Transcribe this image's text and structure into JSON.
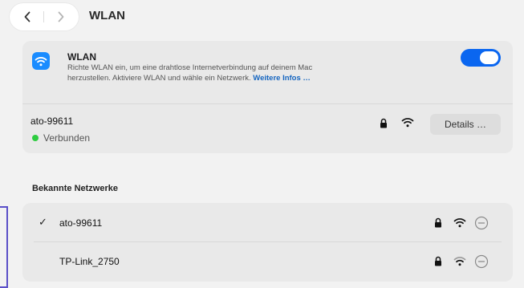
{
  "toolbar": {
    "title": "WLAN",
    "back_icon": "chevron-left-icon",
    "forward_icon": "chevron-right-icon"
  },
  "wlan_section": {
    "title": "WLAN",
    "description_line1": "Richte WLAN ein, um eine drahtlose Internetverbindung auf deinem Mac",
    "description_line2": "herzustellen. Aktiviere WLAN und wähle ein Netzwerk.",
    "more_link": "Weitere Infos …",
    "toggle_on": true,
    "icon": "wifi-icon",
    "accent_color": "#0a66f0"
  },
  "current_network": {
    "name": "ato-99611",
    "status": "Verbunden",
    "status_color": "#2ecc40",
    "details_label": "Details …"
  },
  "known_networks": {
    "label": "Bekannte Netzwerke",
    "items": [
      {
        "name": "ato-99611",
        "check": "✓",
        "connected": true
      },
      {
        "name": "TP-Link_2750",
        "check": "",
        "connected": false
      }
    ]
  }
}
